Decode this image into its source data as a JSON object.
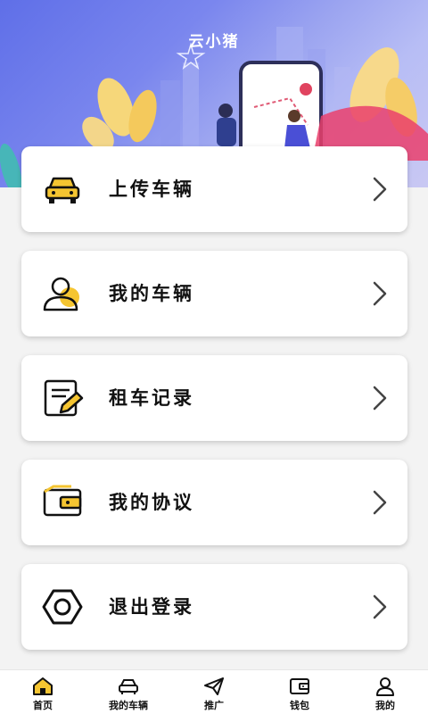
{
  "header": {
    "title": "云小猪"
  },
  "menu": {
    "items": [
      {
        "label": "上传车辆",
        "icon": "car-icon"
      },
      {
        "label": "我的车辆",
        "icon": "user-icon"
      },
      {
        "label": "租车记录",
        "icon": "document-edit-icon"
      },
      {
        "label": "我的协议",
        "icon": "wallet-icon"
      },
      {
        "label": "退出登录",
        "icon": "hex-nut-icon"
      }
    ]
  },
  "tabbar": {
    "tabs": [
      {
        "label": "首页",
        "icon": "home-icon",
        "active": true
      },
      {
        "label": "我的车辆",
        "icon": "car-outline-icon",
        "active": false
      },
      {
        "label": "推广",
        "icon": "paper-plane-icon",
        "active": false
      },
      {
        "label": "钱包",
        "icon": "wallet-outline-icon",
        "active": false
      },
      {
        "label": "我的",
        "icon": "profile-icon",
        "active": false
      }
    ]
  },
  "colors": {
    "accent": "#f5c531",
    "header_gradient_start": "#5f6fe8",
    "header_gradient_end": "#c9c8f3",
    "icon_stroke": "#111111",
    "chevron": "#444444"
  }
}
